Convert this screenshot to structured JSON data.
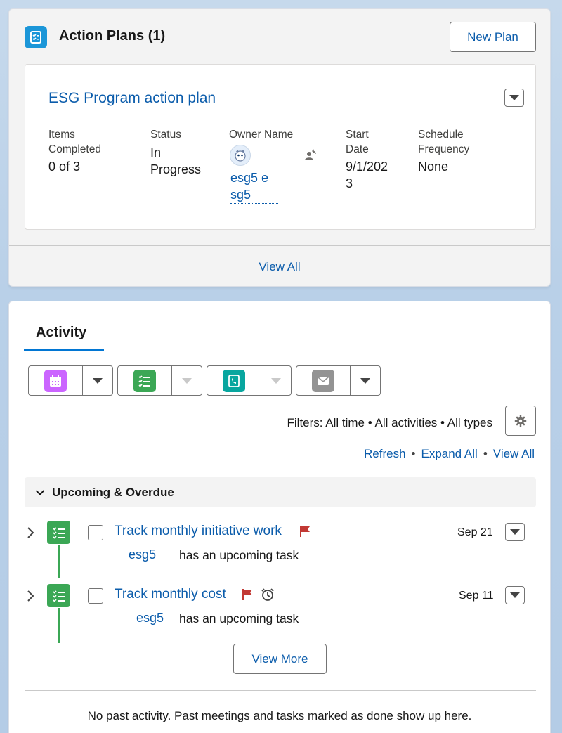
{
  "action_plans": {
    "title": "Action Plans (1)",
    "new_plan_label": "New Plan",
    "plan": {
      "name": "ESG Program action plan",
      "fields": {
        "items_completed_label_1": "Items",
        "items_completed_label_2": "Completed",
        "items_completed_value": "0 of 3",
        "status_label": "Status",
        "status_value_1": "In",
        "status_value_2": "Progress",
        "owner_label": "Owner Name",
        "owner_value_1": "esg5 e",
        "owner_value_2": "sg5",
        "start_label_1": "Start",
        "start_label_2": "Date",
        "start_value_1": "9/1/202",
        "start_value_2": "3",
        "freq_label_1": "Schedule",
        "freq_label_2": "Frequency",
        "freq_value": "None"
      }
    },
    "view_all_label": "View All"
  },
  "activity": {
    "tab_label": "Activity",
    "filters_text": "Filters: All time • All activities • All types",
    "links": {
      "refresh": "Refresh",
      "expand_all": "Expand All",
      "view_all": "View All",
      "separator": "•"
    },
    "section_title": "Upcoming & Overdue",
    "tasks": [
      {
        "title": "Track monthly initiative work",
        "who": "esg5",
        "desc": "has an upcoming task",
        "date": "Sep 21"
      },
      {
        "title": "Track monthly cost",
        "who": "esg5",
        "desc": "has an upcoming task",
        "date": "Sep 11"
      }
    ],
    "view_more_label": "View More",
    "no_past_text": "No past activity. Past meetings and tasks marked as done show up here."
  },
  "colors": {
    "link": "#0b5cab",
    "brand": "#0176d3",
    "event": "#cb65ff",
    "task": "#3ba755",
    "call": "#08a69f",
    "email": "#939393",
    "flag": "#c23934"
  },
  "icons": {
    "action_plan": "checklist-icon",
    "event": "calendar-icon",
    "task": "task-list-icon",
    "call": "phone-icon",
    "email": "envelope-icon",
    "settings": "gear-icon"
  }
}
